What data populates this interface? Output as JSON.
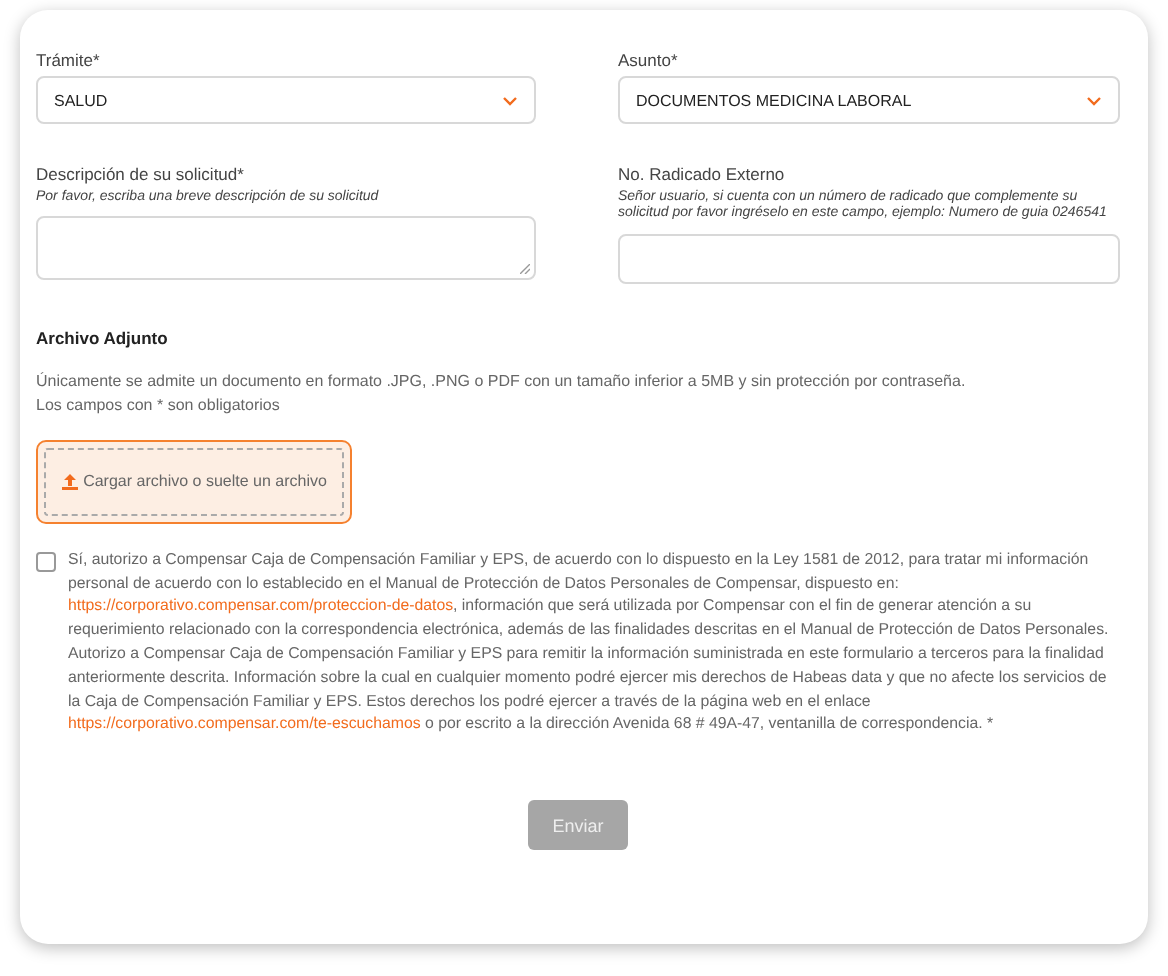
{
  "fields": [
    {
      "kind": "select",
      "label": "Trámite*",
      "value": "SALUD"
    },
    {
      "kind": "select",
      "label": "Asunto*",
      "value": "DOCUMENTOS MEDICINA LABORAL"
    },
    {
      "kind": "textarea",
      "label": "Descripción de su solicitud*",
      "hint": "Por favor, escriba una breve descripción de su solicitud"
    },
    {
      "kind": "input",
      "label": "No. Radicado Externo",
      "hint": "Señor usuario, si cuenta con un número de radicado que complemente su solicitud por favor ingréselo en este campo, ejemplo: Numero de guia 0246541"
    }
  ],
  "attachment": {
    "title": "Archivo Adjunto",
    "notes": [
      "Únicamente se admite un documento en formato .JPG, .PNG o PDF con un tamaño inferior a 5MB y sin protección por contraseña.",
      "Los campos con * son obligatorios"
    ],
    "upload_label": "Cargar archivo o suelte un archivo"
  },
  "consent": {
    "checked": false,
    "parts": [
      {
        "kind": "text",
        "text": "Sí, autorizo a Compensar Caja de Compensación Familiar y EPS, de acuerdo con lo dispuesto en la Ley 1581 de 2012, para tratar mi información personal de acuerdo con lo establecido en el Manual de Protección de Datos Personales de Compensar, dispuesto en: "
      },
      {
        "kind": "link",
        "text": "https://corporativo.compensar.com/proteccion-de-datos"
      },
      {
        "kind": "text",
        "text": ", información que será utilizada por Compensar con el fin de generar atención a su requerimiento relacionado con la correspondencia electrónica, además de las finalidades descritas en el Manual de Protección de Datos Personales. Autorizo a Compensar Caja de Compensación Familiar y EPS para remitir la información suministrada en este formulario a terceros para la finalidad anteriormente descrita. Información sobre la cual en cualquier momento podré ejercer mis derechos de Habeas data y que no afecte los servicios de la Caja de Compensación Familiar y EPS. Estos derechos los podré ejercer a través de la página web en el enlace "
      },
      {
        "kind": "link",
        "text": "https://corporativo.compensar.com/te-escuchamos"
      },
      {
        "kind": "text",
        "text": " o por escrito a la dirección Avenida 68 # 49A-47, ventanilla de correspondencia. *"
      }
    ]
  },
  "submit": {
    "label": "Enviar",
    "disabled": true
  }
}
